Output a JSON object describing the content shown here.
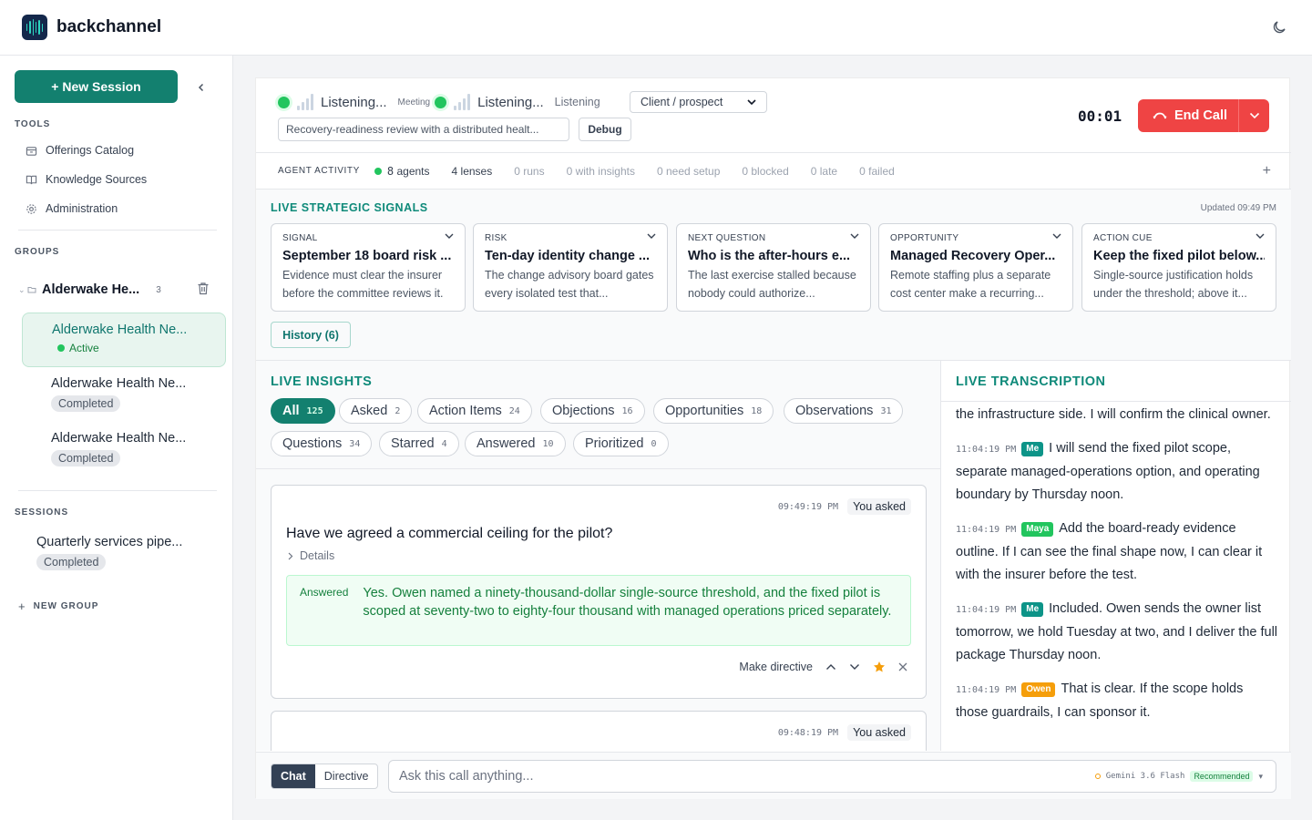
{
  "app": {
    "name": "backchannel",
    "logo_icon": "soundwave-logo-icon",
    "theme_icon": "moon-icon"
  },
  "sidebar": {
    "new_session_label": "+ New Session",
    "tools_title": "TOOLS",
    "tools": [
      {
        "label": "Offerings Catalog",
        "icon": "box-icon"
      },
      {
        "label": "Knowledge Sources",
        "icon": "book-icon"
      },
      {
        "label": "Administration",
        "icon": "gear-icon"
      }
    ],
    "groups_title": "GROUPS",
    "group": {
      "name": "Alderwake He...",
      "count": "3"
    },
    "group_sessions": [
      {
        "title": "Alderwake Health Ne...",
        "status": "Active"
      },
      {
        "title": "Alderwake Health Ne...",
        "status": "Completed"
      },
      {
        "title": "Alderwake Health Ne...",
        "status": "Completed"
      }
    ],
    "sessions_title": "SESSIONS",
    "sessions": [
      {
        "title": "Quarterly services pipe...",
        "status": "Completed"
      }
    ],
    "new_group_label": "NEW GROUP"
  },
  "call": {
    "listening_1": "Listening...",
    "meeting_label": "Meeting",
    "listening_2": "Listening...",
    "listening_label": "Listening",
    "role_select": "Client / prospect",
    "context": "Recovery-readiness review with a distributed healt...",
    "debug_label": "Debug",
    "timer": "00:01",
    "end_call_label": "End Call",
    "end_call_color": "#ef4444"
  },
  "activity": {
    "title": "AGENT ACTIVITY",
    "agents": "8",
    "agents_label": "agents",
    "lenses": "4",
    "lenses_label": "lenses",
    "runs": "0 runs",
    "with_insights": "0 with insights",
    "need_setup": "0 need setup",
    "blocked": "0 blocked",
    "late": "0 late",
    "failed": "0 failed",
    "plus": "+"
  },
  "signals": {
    "title": "LIVE STRATEGIC SIGNALS",
    "updated": "Updated 09:49 PM",
    "cards": [
      {
        "kind": "SIGNAL",
        "headline": "September 18 board risk ...",
        "body": "Evidence must clear the insurer before the committee reviews it."
      },
      {
        "kind": "RISK",
        "headline": "Ten-day identity change ...",
        "body": "The change advisory board gates every isolated test that..."
      },
      {
        "kind": "NEXT QUESTION",
        "headline": "Who is the after-hours e...",
        "body": "The last exercise stalled because nobody could authorize..."
      },
      {
        "kind": "OPPORTUNITY",
        "headline": "Managed Recovery Oper...",
        "body": "Remote staffing plus a separate cost center make a recurring..."
      },
      {
        "kind": "ACTION CUE",
        "headline": "Keep the fixed pilot below...",
        "body": "Single-source justification holds under the threshold; above it..."
      }
    ],
    "history_label": "History (6)"
  },
  "insights": {
    "title": "LIVE INSIGHTS",
    "filters": [
      {
        "label": "All",
        "count": "125"
      },
      {
        "label": "Asked",
        "count": "2"
      },
      {
        "label": "Action Items",
        "count": "24"
      },
      {
        "label": "Objections",
        "count": "16"
      },
      {
        "label": "Opportunities",
        "count": "18"
      },
      {
        "label": "Observations",
        "count": "31"
      },
      {
        "label": "Questions",
        "count": "34"
      },
      {
        "label": "Starred",
        "count": "4"
      },
      {
        "label": "Answered",
        "count": "10"
      },
      {
        "label": "Prioritized",
        "count": "0"
      }
    ],
    "cards": [
      {
        "time": "09:49:19 PM",
        "tag": "You asked",
        "question": "Have we agreed a commercial ceiling for the pilot?",
        "details_label": "Details",
        "answer_label": "Answered",
        "answer": "Yes. Owen named a ninety-thousand-dollar single-source threshold, and the fixed pilot is scoped at seventy-two to eighty-four thousand with managed operations priced separately.",
        "directive_label": "Make directive"
      },
      {
        "time": "09:48:19 PM",
        "tag": "You asked"
      }
    ]
  },
  "transcript": {
    "title": "LIVE TRANSCRIPTION",
    "lead": "the infrastructure side. I will confirm the clinical owner.",
    "lines": [
      {
        "time": "11:04:19 PM",
        "speaker": "Me",
        "text": "I will send the fixed pilot scope, separate managed-operations option, and operating boundary by Thursday noon."
      },
      {
        "time": "11:04:19 PM",
        "speaker": "Maya",
        "text": "Add the board-ready evidence outline. If I can see the final shape now, I can clear it with the insurer before the test."
      },
      {
        "time": "11:04:19 PM",
        "speaker": "Me",
        "text": "Included. Owen sends the owner list tomorrow, we hold Tuesday at two, and I deliver the full package Thursday noon."
      },
      {
        "time": "11:04:19 PM",
        "speaker": "Owen",
        "text": "That is clear. If the scope holds those guardrails, I can sponsor it."
      }
    ]
  },
  "chat": {
    "mode_chat": "Chat",
    "mode_directive": "Directive",
    "placeholder": "Ask this call anything...",
    "model": "Gemini 3.6 Flash",
    "recommended": "Recommended",
    "model_caret": "▾"
  }
}
